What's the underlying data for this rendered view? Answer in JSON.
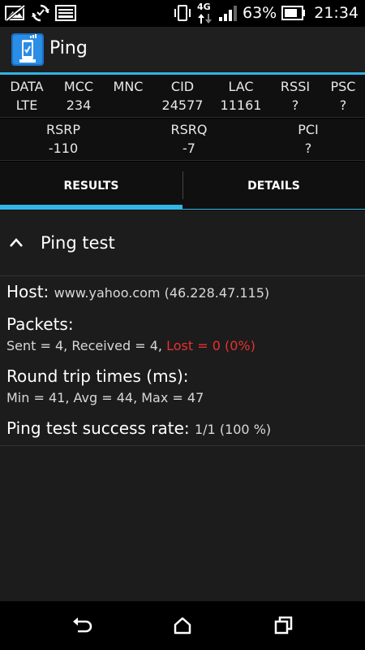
{
  "status_bar": {
    "icons_left": [
      "image-icon",
      "sync-icon",
      "keyboard-icon"
    ],
    "network_type": "4G",
    "battery_percent": "63%",
    "time": "21:34"
  },
  "app": {
    "title": "Ping",
    "accent_color": "#33b5e5"
  },
  "info_row1": [
    {
      "label": "DATA",
      "value": "LTE"
    },
    {
      "label": "MCC",
      "value": "234"
    },
    {
      "label": "MNC",
      "value": ""
    },
    {
      "label": "CID",
      "value": "24577"
    },
    {
      "label": "LAC",
      "value": "11161"
    },
    {
      "label": "RSSI",
      "value": "?"
    },
    {
      "label": "PSC",
      "value": "?"
    }
  ],
  "info_row2": [
    {
      "label": "RSRP",
      "value": "-110"
    },
    {
      "label": "RSRQ",
      "value": "-7"
    },
    {
      "label": "PCI",
      "value": "?"
    }
  ],
  "tabs": [
    {
      "label": "RESULTS",
      "selected": true
    },
    {
      "label": "DETAILS",
      "selected": false
    }
  ],
  "section": {
    "title": "Ping test",
    "host_label": "Host:",
    "host_value": "www.yahoo.com (46.228.47.115)",
    "packets_label": "Packets:",
    "packets_text": "Sent = 4, Received = 4,",
    "packets_lost": "Lost = 0 (0%)",
    "rtt_label": "Round trip times (ms):",
    "rtt_text": "Min = 41, Avg = 44, Max = 47",
    "success_label": "Ping test success rate:",
    "success_value": "1/1 (100 %)"
  }
}
